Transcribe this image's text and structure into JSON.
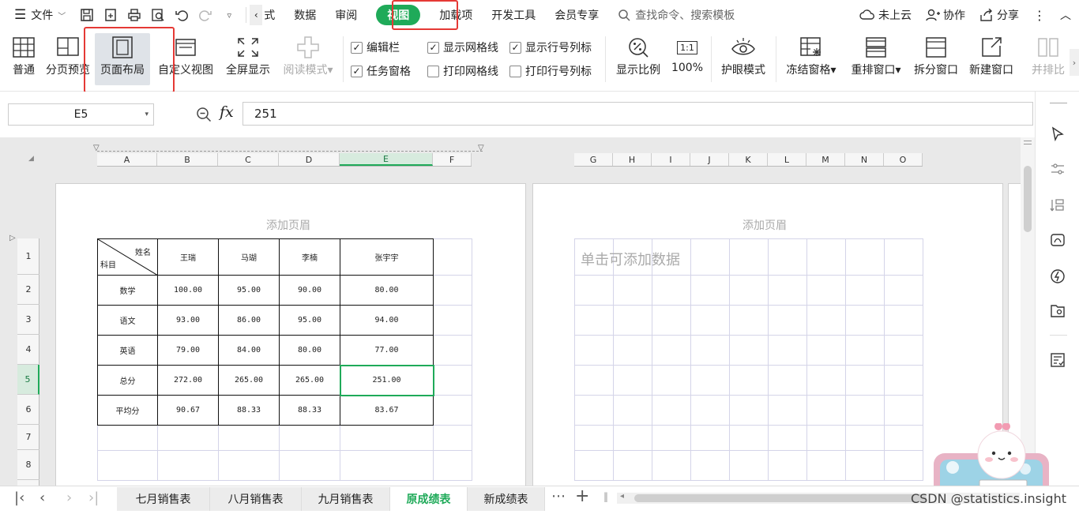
{
  "menubar": {
    "file_label": "文件",
    "tabs": [
      "公式",
      "数据",
      "审阅",
      "视图",
      "加载项",
      "开发工具",
      "会员专享"
    ],
    "tabs_visible": [
      "式",
      "数据",
      "审阅",
      "视图",
      "加载项",
      "开发工具",
      "会员专享"
    ],
    "active_tab": "视图",
    "search_placeholder": "查找命令、搜索模板",
    "cloud": "未上云",
    "collab": "协作",
    "share": "分享"
  },
  "ribbon": {
    "normal": "普通",
    "page_break_preview": "分页预览",
    "page_layout": "页面布局",
    "custom_view": "自定义视图",
    "full_screen": "全屏显示",
    "reading_mode": "阅读模式",
    "checks": {
      "formula_bar": "编辑栏",
      "show_gridlines": "显示网格线",
      "show_headings": "显示行号列标",
      "task_pane": "任务窗格",
      "print_gridlines": "打印网格线",
      "print_headings": "打印行号列标"
    },
    "zoom": "显示比例",
    "zoom_100": "100%",
    "zoom_100_icon": "1:1",
    "eye_mode": "护眼模式",
    "freeze": "冻结窗格",
    "rearrange": "重排窗口",
    "split": "拆分窗口",
    "new_window": "新建窗口",
    "side_by_side": "并排比"
  },
  "formula": {
    "cell_ref": "E5",
    "fx": "fx",
    "value": "251"
  },
  "sheet": {
    "col_headers_left": [
      "A",
      "B",
      "C",
      "D",
      "E",
      "F"
    ],
    "col_headers_right": [
      "G",
      "H",
      "I",
      "J",
      "K",
      "L",
      "M",
      "N",
      "O"
    ],
    "row_headers": [
      "1",
      "2",
      "3",
      "4",
      "5",
      "6",
      "7",
      "8"
    ],
    "header_hint": "添加页眉",
    "click_add": "单击可添加数据",
    "diag_top": "姓名",
    "diag_bottom": "科目",
    "names": [
      "王瑞",
      "马瑚",
      "李楠",
      "张宇宇"
    ],
    "rows": [
      {
        "subject": "数学",
        "values": [
          "100.00",
          "95.00",
          "90.00",
          "80.00"
        ]
      },
      {
        "subject": "语文",
        "values": [
          "93.00",
          "86.00",
          "95.00",
          "94.00"
        ]
      },
      {
        "subject": "英语",
        "values": [
          "79.00",
          "84.00",
          "80.00",
          "77.00"
        ]
      },
      {
        "subject": "总分",
        "values": [
          "272.00",
          "265.00",
          "265.00",
          "251.00"
        ]
      },
      {
        "subject": "平均分",
        "values": [
          "90.67",
          "88.33",
          "88.33",
          "83.67"
        ]
      }
    ]
  },
  "sheet_tabs": [
    "七月销售表",
    "八月销售表",
    "九月销售表",
    "原成绩表",
    "新成绩表"
  ],
  "active_sheet": "原成绩表",
  "watermark": "CSDN @statistics.insight"
}
